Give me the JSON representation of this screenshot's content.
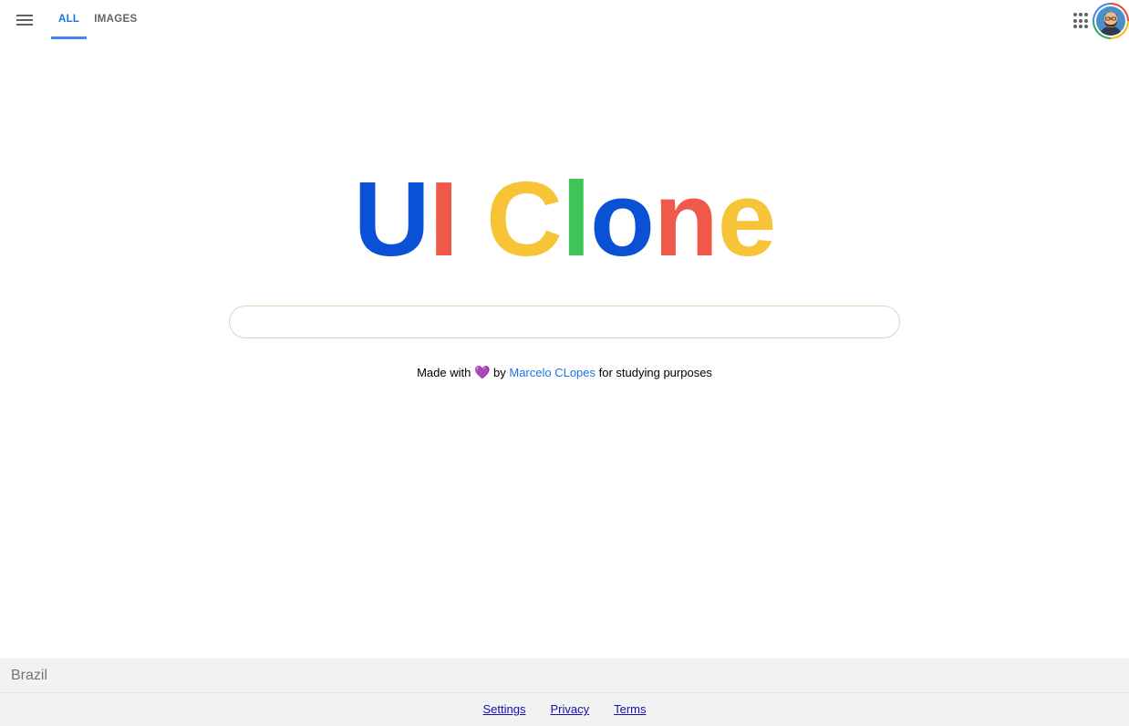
{
  "header": {
    "tabs": [
      {
        "label": "ALL",
        "active": true
      },
      {
        "label": "IMAGES",
        "active": false
      }
    ],
    "icons": {
      "menu": "hamburger-menu-icon",
      "apps": "apps-grid-icon",
      "avatar": "user-avatar"
    }
  },
  "logo": {
    "letters": [
      {
        "char": "U",
        "color": "#0b51d6"
      },
      {
        "char": "I",
        "color": "#f0584a"
      },
      {
        "char": " ",
        "color": "#ffffff"
      },
      {
        "char": "C",
        "color": "#f8c437"
      },
      {
        "char": "l",
        "color": "#3fc555"
      },
      {
        "char": "o",
        "color": "#0b51d6"
      },
      {
        "char": "n",
        "color": "#f0584a"
      },
      {
        "char": "e",
        "color": "#f8c437"
      }
    ]
  },
  "search": {
    "value": "",
    "placeholder": ""
  },
  "credits": {
    "prefix": "Made with",
    "heart": "💜",
    "by": "by",
    "author": "Marcelo CLopes",
    "suffix": "for studying purposes"
  },
  "footer": {
    "country": "Brazil",
    "links": [
      "Settings",
      "Privacy",
      "Terms"
    ]
  }
}
